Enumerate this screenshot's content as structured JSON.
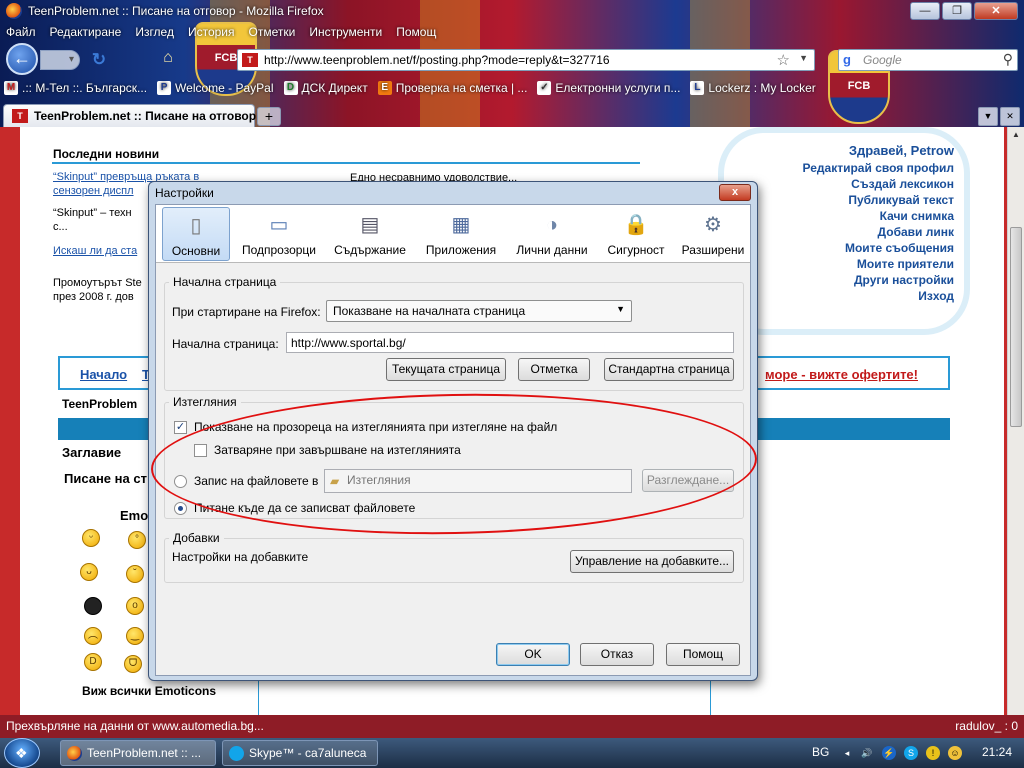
{
  "window": {
    "title": "TeenProblem.net :: Писане на отговор - Mozilla Firefox",
    "buttons": [
      "—",
      "❐",
      "✕"
    ]
  },
  "menu": [
    "Файл",
    "Редактиране",
    "Изглед",
    "История",
    "Отметки",
    "Инструменти",
    "Помощ"
  ],
  "nav": {
    "url": "http://www.teenproblem.net/f/posting.php?mode=reply&t=327716",
    "search_placeholder": "Google"
  },
  "bookmarks": [
    {
      "icon": "M",
      "label": ".:: М-Тел ::. Българск..."
    },
    {
      "icon": "P",
      "label": "Welcome - PayPal"
    },
    {
      "icon": "D",
      "label": "ДСК Директ"
    },
    {
      "icon": "E",
      "label": "Проверка на сметка | ..."
    },
    {
      "icon": "✓",
      "label": "Електронни услуги п..."
    },
    {
      "icon": "L",
      "label": "Lockerz : My Locker"
    }
  ],
  "tabs": [
    {
      "label": "TeenProblem.net :: Писане на отговор"
    }
  ],
  "crest_label": "FCB",
  "page": {
    "news_title": "Последни новини",
    "news_items": [
      "“Skinput” превръща ръката в",
      "сензорен диспл",
      "“Skinput” – техн",
      "с...",
      "Искаш ли да ста",
      "Промоутърът Ste",
      "през 2008 г. дов"
    ],
    "news_side": "Едно несравнимо удоволствие...",
    "user_links": [
      "Здравей, Petrow",
      "Редактирай своя профил",
      "Създай лексикон",
      "Публикувай текст",
      "Качи снимка",
      "Добави линк",
      "Моите съобщения",
      "Моите приятели",
      "Други настройки",
      "Изход"
    ],
    "nav_links": [
      "Начало",
      "Т"
    ],
    "promo": "море - вижте офертите!",
    "section_label": "TeenProblem",
    "col_title": "Заглавие",
    "write_label": "Писане на ст",
    "emo_label": "Emo",
    "emoticons_link": "Виж всички Emoticons"
  },
  "dialog": {
    "title": "Настройки",
    "close": "x",
    "categories": [
      {
        "label": "Основни",
        "icon": "▯"
      },
      {
        "label": "Подпрозорци",
        "icon": "▭"
      },
      {
        "label": "Съдържание",
        "icon": "▤"
      },
      {
        "label": "Приложения",
        "icon": "▦"
      },
      {
        "label": "Лични данни",
        "icon": "◑"
      },
      {
        "label": "Сигурност",
        "icon": "🔒"
      },
      {
        "label": "Разширени",
        "icon": "⚙"
      }
    ],
    "home_group": "Начална страница",
    "startup_label": "При стартиране на Firefox:",
    "startup_value": "Показване на началната страница",
    "homepage_label": "Начална страница:",
    "homepage_value": "http://www.sportal.bg/",
    "btn_current": "Текущата страница",
    "btn_bookmark": "Отметка",
    "btn_default": "Стандартна страница",
    "downloads_group": "Изтегляния",
    "show_window": "Показване на прозореца на изтеглянията при изтегляне на файл",
    "close_when_done": "Затваряне при завършване на изтеглянията",
    "save_to": "Запис на файловете в",
    "save_folder": "Изтегляния",
    "browse": "Разглеждане...",
    "ask_where": "Питане къде да се записват файловете",
    "addons_group": "Добавки",
    "addons_settings": "Настройки на добавките",
    "manage_addons": "Управление на добавките...",
    "ok": "OK",
    "cancel": "Отказ",
    "help": "Помощ"
  },
  "status": {
    "text": "Прехвърляне на данни от www.automedia.bg...",
    "right": "radulov_ : 0"
  },
  "taskbar": {
    "items": [
      "TeenProblem.net :: ...",
      "Skype™ - ca7aluneca"
    ],
    "lang": "BG",
    "clock": "21:24"
  }
}
